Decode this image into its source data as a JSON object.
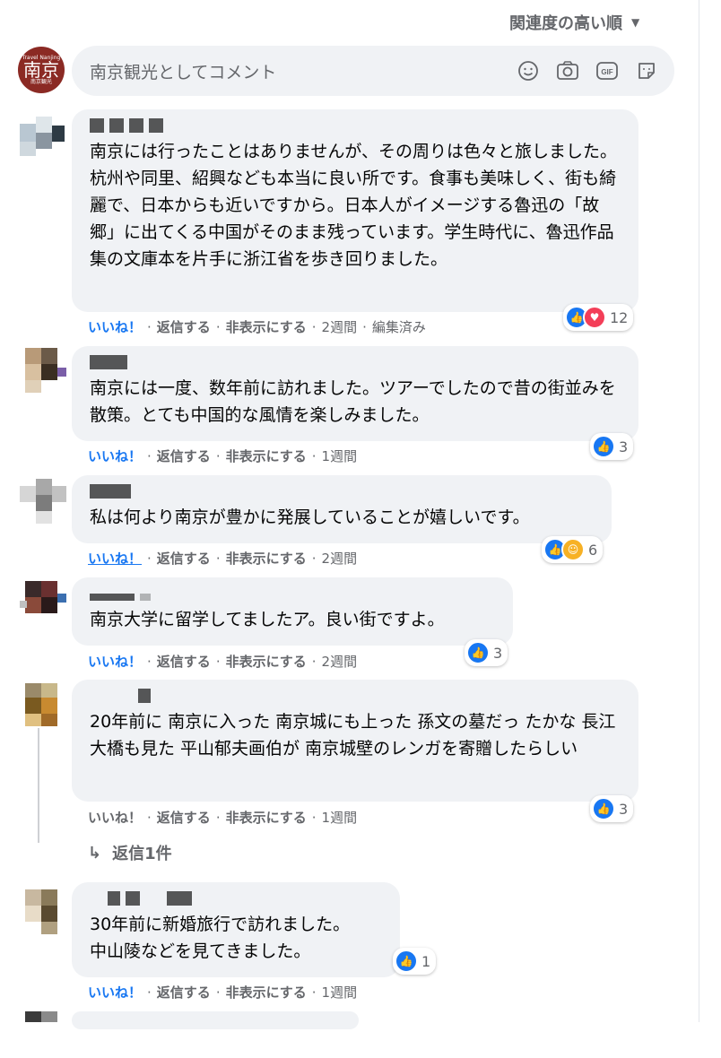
{
  "sort_label": "関連度の高い順",
  "me": {
    "avatar_small_top": "Travel Nanjing",
    "avatar_big": "南京",
    "avatar_small_bottom": "南京観光"
  },
  "composer": {
    "placeholder": "南京観光としてコメント",
    "icons": [
      "emoji-icon",
      "camera-icon",
      "gif-icon",
      "sticker-icon"
    ],
    "gif_label": "GIF"
  },
  "actions": {
    "like": "いいね！",
    "reply": "返信する",
    "hide": "非表示にする",
    "sep": "·"
  },
  "comments": [
    {
      "text": "南京には行ったことはありませんが、その周りは色々と旅しました。杭州や同里、紹興なども本当に良い所です。食事も美味しく、街も綺麗で、日本からも近いですから。日本人がイメージする魯迅の「故郷」に出てくる中国がそのまま残っています。学生時代に、魯迅作品集の文庫本を片手に浙江省を歩き回りました。",
      "time": "2週間",
      "edited": "編集済み",
      "reaction_count": "12"
    },
    {
      "text": "南京には一度、数年前に訪れました。ツアーでしたので昔の街並みを散策。とても中国的な風情を楽しみました。",
      "time": "1週間",
      "reaction_count": "3"
    },
    {
      "text": "私は何より南京が豊かに発展していることが嬉しいです。",
      "time": "2週間",
      "reaction_count": "6"
    },
    {
      "text": "南京大学に留学してましたア。良い街ですよ。",
      "time": "2週間",
      "reaction_count": "3"
    },
    {
      "text": "20年前に 南京に入った 南京城にも上った 孫文の墓だっ たかな 長江大橋も見た 平山郁夫画伯が 南京城壁のレンガを寄贈したらしい",
      "time": "1週間",
      "reaction_count": "3",
      "reply_label": "返信1件"
    },
    {
      "text": "30年前に新婚旅行で訪れました。\n中山陵などを見てきました。",
      "time": "1週間",
      "reaction_count": "1"
    }
  ],
  "colors": {
    "accent": "#1877f2",
    "bubble": "#f0f2f5",
    "muted": "#65676b",
    "brand": "#8b2a24"
  }
}
